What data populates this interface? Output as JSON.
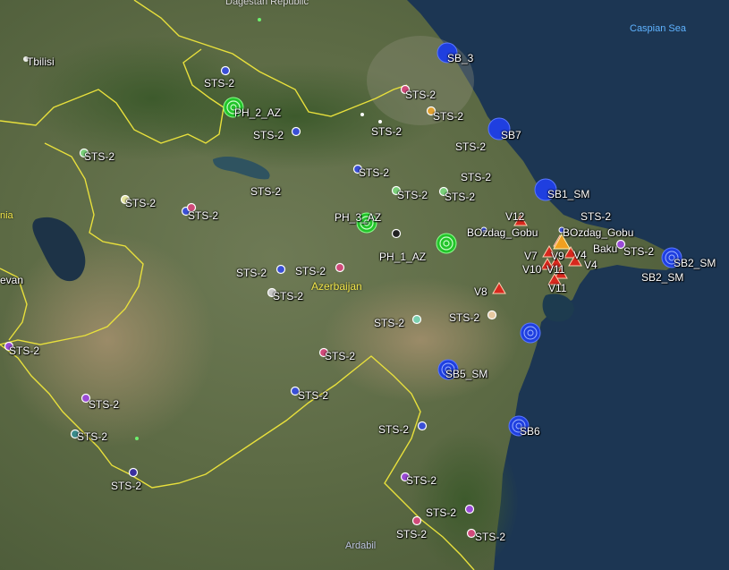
{
  "places": {
    "dagestan": "Dagestan Republic",
    "tbilisi": "Tbilisi",
    "caspian": "Caspian Sea",
    "azerbaijan": "Azerbaijan",
    "baku": "Baku",
    "ardabil": "Ardabil",
    "yerevan": "evan",
    "armenia": "nia"
  },
  "stations": {
    "sb3": "SB_3",
    "sb7": "SB7",
    "sb1sm": "SB1_SM",
    "sb2sm_a": "SB2_SM",
    "sb2sm_b": "SB2_SM",
    "sb5sm": "SB5_SM",
    "sb6": "SB6",
    "ph2": "PH_2_AZ",
    "ph3": "PH_3_AZ",
    "ph1": "PH_1_AZ",
    "bozdag1": "BOzdag_Gobu",
    "bozdag2": "BOzdag_Gobu",
    "sts": "STS-2"
  },
  "volcanoes": {
    "v12": "V12",
    "v7": "V7",
    "v9": "V9",
    "v4a": "V4",
    "v4b": "V4",
    "v10": "V10",
    "v11a": "V11",
    "v11b": "V11",
    "v8": "V8"
  },
  "colors": {
    "sb_station": "#1f3fe0",
    "ph_station": "#22c42a",
    "volcano": "#d8281e",
    "border": "#e8e03c"
  }
}
